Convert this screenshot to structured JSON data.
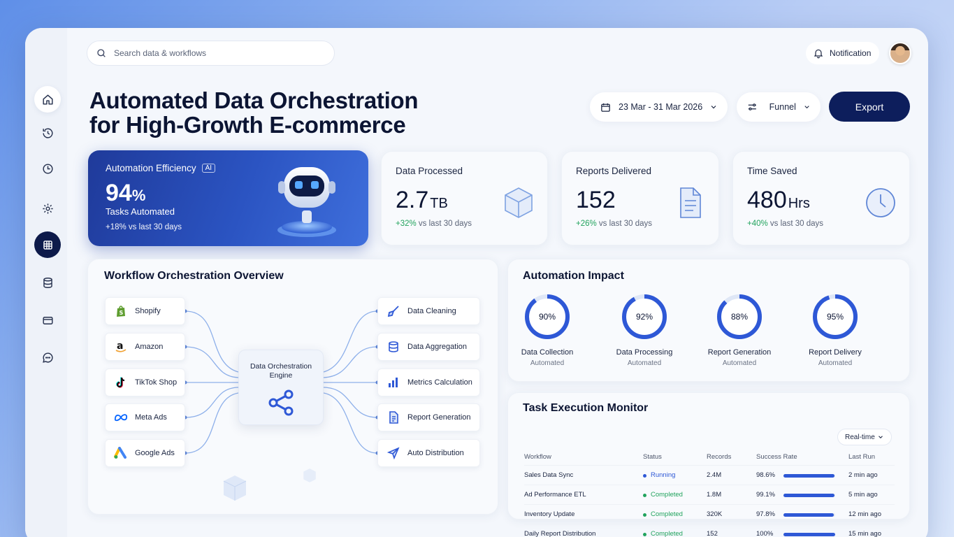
{
  "search": {
    "placeholder": "Search data & workflows"
  },
  "header": {
    "notification_label": "Notification"
  },
  "page": {
    "title_line1": "Automated Data Orchestration",
    "title_line2": "for High-Growth E-commerce",
    "date_range": "23 Mar - 31 Mar 2026",
    "filter_label": "Funnel",
    "export_label": "Export"
  },
  "sidebar": {
    "items": [
      {
        "icon": "home-icon"
      },
      {
        "icon": "history-icon"
      },
      {
        "icon": "clock-icon"
      },
      {
        "icon": "gear-icon"
      },
      {
        "icon": "grid-icon",
        "active": true
      },
      {
        "icon": "database-icon"
      },
      {
        "icon": "card-icon"
      },
      {
        "icon": "chat-icon"
      }
    ]
  },
  "kpi": {
    "efficiency": {
      "label": "Automation Efficiency",
      "badge": "AI",
      "value": "94",
      "unit": "%",
      "sub": "Tasks Automated",
      "change": "+18% vs last 30 days"
    },
    "data_processed": {
      "label": "Data Processed",
      "value": "2.7",
      "unit": "TB",
      "change_pct": "+32%",
      "change_text": " vs last 30 days"
    },
    "reports_delivered": {
      "label": "Reports Delivered",
      "value": "152",
      "unit": "",
      "change_pct": "+26%",
      "change_text": " vs last 30 days"
    },
    "time_saved": {
      "label": "Time Saved",
      "value": "480",
      "unit": "Hrs",
      "change_pct": "+40%",
      "change_text": " vs last 30 days"
    }
  },
  "workflow": {
    "title": "Workflow Orchestration Overview",
    "sources": [
      "Shopify",
      "Amazon",
      "TikTok Shop",
      "Meta Ads",
      "Google Ads"
    ],
    "engine_line1": "Data Orchestration",
    "engine_line2": "Engine",
    "outputs": [
      "Data Cleaning",
      "Data Aggregation",
      "Metrics Calculation",
      "Report Generation",
      "Auto Distribution"
    ]
  },
  "impact": {
    "title": "Automation Impact",
    "rings": [
      {
        "name": "Data Collection",
        "sub": "Automated",
        "pct": 90,
        "label": "90%"
      },
      {
        "name": "Data Processing",
        "sub": "Automated",
        "pct": 92,
        "label": "92%"
      },
      {
        "name": "Report Generation",
        "sub": "Automated",
        "pct": 88,
        "label": "88%"
      },
      {
        "name": "Report Delivery",
        "sub": "Automated",
        "pct": 95,
        "label": "95%"
      }
    ]
  },
  "tasks": {
    "title": "Task Execution Monitor",
    "mode": "Real-time",
    "columns": [
      "Workflow",
      "Status",
      "Records",
      "Success Rate",
      "Last Run"
    ],
    "rows": [
      {
        "workflow": "Sales Data Sync",
        "status": "Running",
        "status_color": "#2e58d6",
        "records": "2.4M",
        "rate": "98.6%",
        "rate_value": 98.6,
        "last_run": "2 min ago"
      },
      {
        "workflow": "Ad Performance ETL",
        "status": "Completed",
        "status_color": "#21a35d",
        "records": "1.8M",
        "rate": "99.1%",
        "rate_value": 99.1,
        "last_run": "5 min ago"
      },
      {
        "workflow": "Inventory Update",
        "status": "Completed",
        "status_color": "#21a35d",
        "records": "320K",
        "rate": "97.8%",
        "rate_value": 97.8,
        "last_run": "12 min ago"
      },
      {
        "workflow": "Daily Report Distribution",
        "status": "Completed",
        "status_color": "#21a35d",
        "records": "152",
        "rate": "100%",
        "rate_value": 100,
        "last_run": "15 min ago"
      }
    ]
  }
}
